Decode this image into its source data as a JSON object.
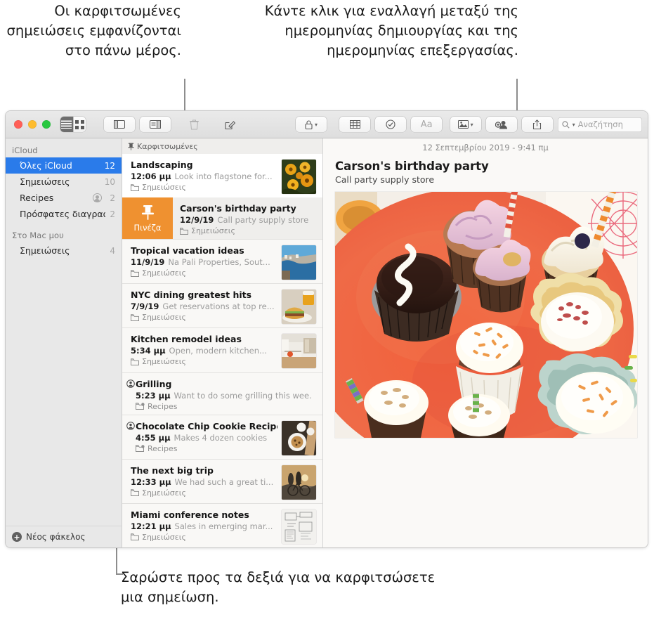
{
  "callouts": {
    "pinned": "Οι καρφιτσωμένες σημειώσεις εμφανίζονται στο πάνω μέρος.",
    "dates": "Κάντε κλικ για εναλλαγή μεταξύ της ημερομηνίας δημιουργίας και της ημερομηνίας επεξεργασίας.",
    "swipe": "Σαρώστε προς τα δεξιά για να καρφιτσώσετε μια σημείωση."
  },
  "toolbar": {
    "view_list_icon": "list-view-icon",
    "view_grid_icon": "gallery-view-icon",
    "sidebar_icon": "sidebar-toggle-icon",
    "attachments_icon": "attachments-browser-icon",
    "delete_icon": "trash-icon",
    "compose_icon": "compose-note-icon",
    "lock_icon": "lock-icon",
    "table_icon": "table-icon",
    "checklist_icon": "checklist-icon",
    "format_label": "Aa",
    "media_icon": "media-icon",
    "share_people_icon": "add-people-icon",
    "share_icon": "share-icon",
    "search_icon": "search-icon",
    "search_placeholder": "Αναζήτηση",
    "search_value": ""
  },
  "sidebar": {
    "sections": [
      {
        "header": "iCloud",
        "items": [
          {
            "label": "Όλες iCloud",
            "count": "12",
            "selected": true,
            "shared": false
          },
          {
            "label": "Σημειώσεις",
            "count": "10",
            "selected": false,
            "shared": false
          },
          {
            "label": "Recipes",
            "count": "2",
            "selected": false,
            "shared": true
          },
          {
            "label": "Πρόσφατες διαγραφές",
            "count": "2",
            "selected": false,
            "shared": false
          }
        ]
      },
      {
        "header": "Στο Mac μου",
        "items": [
          {
            "label": "Σημειώσεις",
            "count": "4",
            "selected": false,
            "shared": false
          }
        ]
      }
    ],
    "new_folder_label": "Νέος φάκελος"
  },
  "notelist": {
    "pinned_header": "Καρφιτσωμένες",
    "swipe_action_label": "Πινέζα",
    "notes": [
      {
        "title": "Landscaping",
        "when": "12:06 μμ",
        "snippet": "Look into flagstone for...",
        "folder": "Σημειώσεις",
        "shared": false,
        "pinned": true,
        "swiped": false,
        "thumb": "flowers"
      },
      {
        "title": "Carson's birthday party",
        "when": "12/9/19",
        "snippet": "Call party supply store",
        "folder": "Σημειώσεις",
        "shared": false,
        "pinned": false,
        "swiped": true,
        "selected": true,
        "thumb": "none"
      },
      {
        "title": "Tropical vacation ideas",
        "when": "11/9/19",
        "snippet": "Na Pali Properties, Sout...",
        "folder": "Σημειώσεις",
        "shared": false,
        "pinned": false,
        "swiped": false,
        "thumb": "coast"
      },
      {
        "title": "NYC dining greatest hits",
        "when": "7/9/19",
        "snippet": "Get reservations at top re...",
        "folder": "Σημειώσεις",
        "shared": false,
        "pinned": false,
        "swiped": false,
        "thumb": "burger"
      },
      {
        "title": "Kitchen remodel ideas",
        "when": "5:34 μμ",
        "snippet": "Open, modern kitchen...",
        "folder": "Σημειώσεις",
        "shared": false,
        "pinned": false,
        "swiped": false,
        "thumb": "kitchen"
      },
      {
        "title": "Grilling",
        "when": "5:23 μμ",
        "snippet": "Want to do some grilling this wee...",
        "folder": "Recipes",
        "shared": true,
        "pinned": false,
        "swiped": false,
        "thumb": "none"
      },
      {
        "title": "Chocolate Chip Cookie Recipe",
        "when": "4:55 μμ",
        "snippet": "Makes 4 dozen cookies",
        "folder": "Recipes",
        "shared": true,
        "pinned": false,
        "swiped": false,
        "thumb": "cookies"
      },
      {
        "title": "The next big trip",
        "when": "12:33 μμ",
        "snippet": "We had such a great ti...",
        "folder": "Σημειώσεις",
        "shared": false,
        "pinned": false,
        "swiped": false,
        "thumb": "bike"
      },
      {
        "title": "Miami conference notes",
        "when": "12:21 μμ",
        "snippet": "Sales in emerging mar...",
        "folder": "Σημειώσεις",
        "shared": false,
        "pinned": false,
        "swiped": false,
        "thumb": "sketch"
      }
    ]
  },
  "detail": {
    "date": "12 Σεπτεμβρίου 2019 - 9:41 πμ",
    "title": "Carson's birthday party",
    "body_line": "Call party supply store",
    "photo_alt": "cupcakes-on-orange-plate"
  },
  "colors": {
    "accent_selected": "#2a7bea",
    "swipe_pin": "#ef9130",
    "window_chrome": "#ececec",
    "list_bg": "#f7f6f4"
  }
}
